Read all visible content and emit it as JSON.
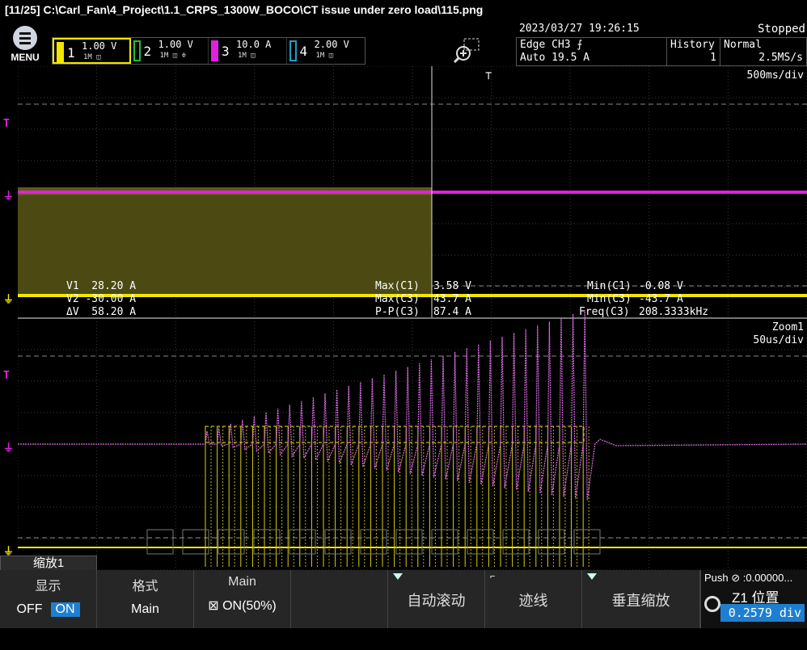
{
  "title": "[11/25]  C:\\Carl_Fan\\4_Project\\1.1_CRPS_1300W_BOCO\\CT issue under zero load\\115.png",
  "menu": {
    "label": "MENU"
  },
  "channels": [
    {
      "num": "1",
      "scale": "1.00 V",
      "color": "#f2e600"
    },
    {
      "num": "2",
      "scale": "1.00 V",
      "color": "#1fbf3f"
    },
    {
      "num": "3",
      "scale": "10.0 A",
      "color": "#e020e0"
    },
    {
      "num": "4",
      "scale": "2.00 V",
      "color": "#1e9ec8"
    }
  ],
  "trigger": {
    "datetime": "2023/03/27  19:26:15",
    "state": "Stopped",
    "edge": "Edge CH3 ⨍",
    "auto": "Auto 19.5 A",
    "history_label": "History",
    "history_value": "1",
    "mode": "Normal",
    "rate": "2.5MS/s"
  },
  "main_window": {
    "timebase": "500ms/div"
  },
  "zoom_window": {
    "name": "Zoom1",
    "timebase": "50us/div"
  },
  "cursors": {
    "v1": "V1  28.20 A",
    "v2": "V2 -30.00 A",
    "dv": "ΔV  58.20 A"
  },
  "measurements": {
    "max_c1_label": "Max(C1)",
    "max_c1": "3.58 V",
    "max_c3_label": "Max(C3)",
    "max_c3": "43.7 A",
    "pp_c3_label": "P-P(C3)",
    "pp_c3": "87.4 A",
    "min_c1_label": "Min(C1)",
    "min_c1": "-0.08 V",
    "min_c3_label": "Min(C3)",
    "min_c3": "-43.7 A",
    "freq_c3_label": "Freq(C3)",
    "freq_c3": "208.3333kHz"
  },
  "bottom": {
    "tab": "缩放1",
    "display_label": "显示",
    "display_off": "OFF",
    "display_on": "ON",
    "format_label": "格式",
    "format_value": "Main",
    "main_label": "Main",
    "main_value": "ON(50%)",
    "auto_scroll": "自动滚动",
    "trace": "迹线",
    "vzoom": "垂直缩放",
    "knob_push": "Push ⊘ :0.00000...",
    "knob_label": "Z1  位置",
    "knob_value": "0.2579 div"
  }
}
